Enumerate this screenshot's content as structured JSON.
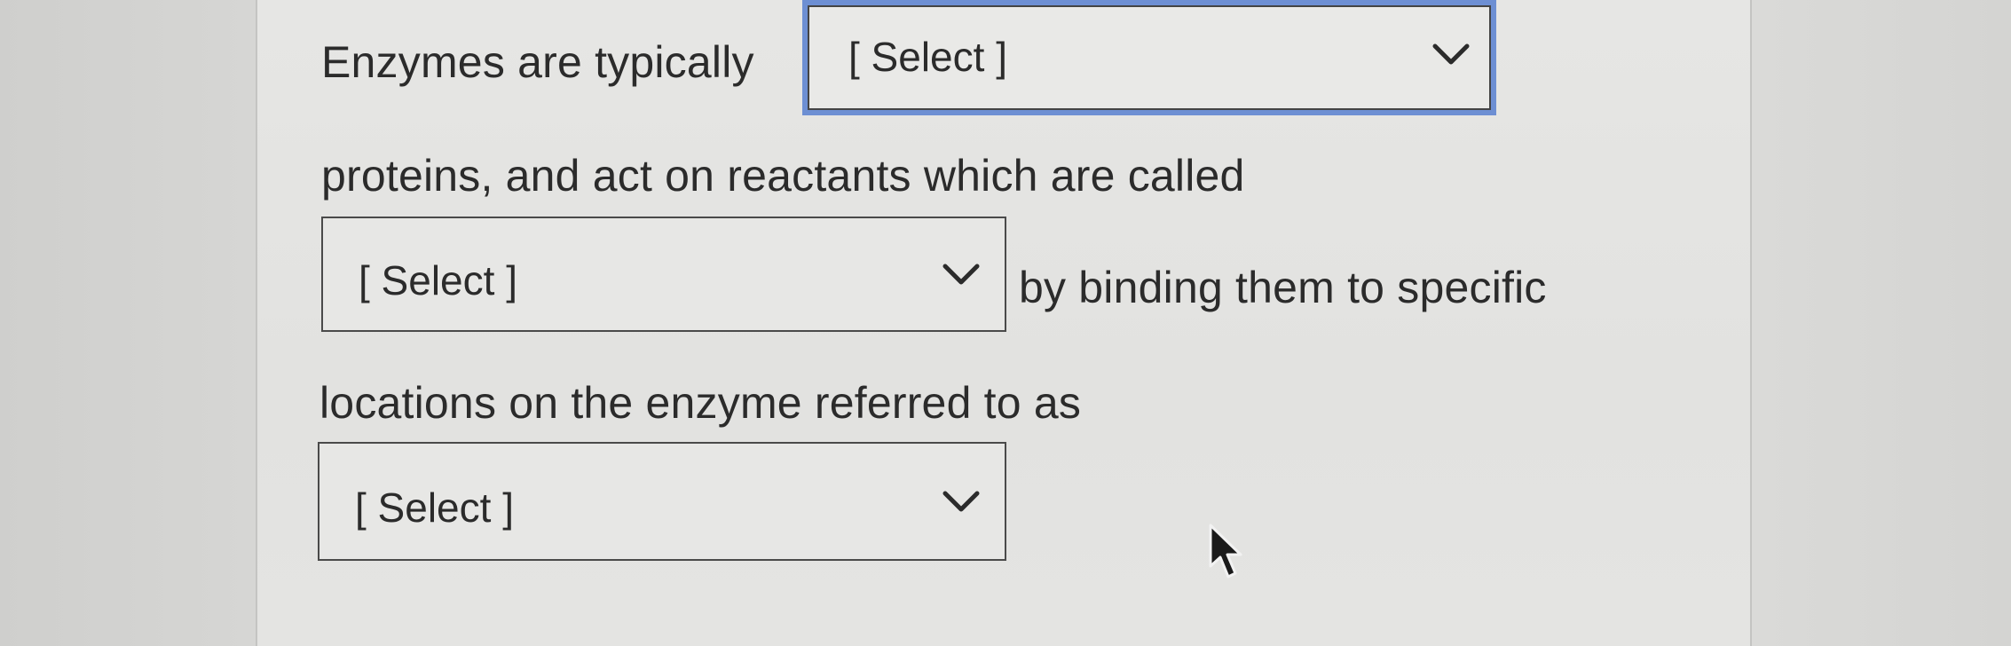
{
  "question": {
    "line1": "Enzymes are typically",
    "line2": "proteins, and act on reactants which are called",
    "line3_after": "by binding them to specific",
    "line4": "locations on the enzyme referred to as"
  },
  "dropdowns": [
    {
      "value": "[ Select ]"
    },
    {
      "value": "[ Select ]"
    },
    {
      "value": "[ Select ]"
    }
  ],
  "colors": {
    "focus_border": "#6d8fd3",
    "text": "#2b2b2b"
  },
  "icons": {
    "dropdown": "chevron-down-icon",
    "pointer": "mouse-cursor-icon"
  }
}
